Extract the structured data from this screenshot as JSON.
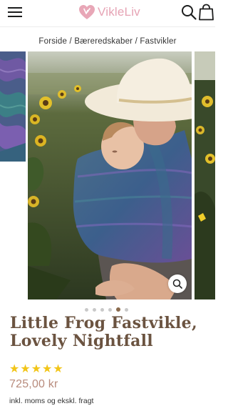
{
  "header": {
    "logo_text": "VikleLiv",
    "logo_color": "#e6a3b4",
    "menu_icon": "hamburger-menu-icon",
    "search_icon": "search-icon",
    "cart_icon": "shopping-bag-icon"
  },
  "breadcrumb": {
    "items": [
      "Forside",
      "Bæreredskaber",
      "Fastvikler"
    ],
    "separator": "/"
  },
  "gallery": {
    "slide_count": 6,
    "active_index": 4,
    "zoom_icon": "zoom-icon"
  },
  "product": {
    "title": "Little Frog Fastvikle, Lovely Nightfall",
    "rating": 5,
    "rating_max": 5,
    "price": "725,00 kr",
    "tax_note": "inkl. moms og ekskl. fragt",
    "title_color": "#6b5340",
    "price_color": "#b88b7c",
    "star_color": "#f2c518"
  }
}
